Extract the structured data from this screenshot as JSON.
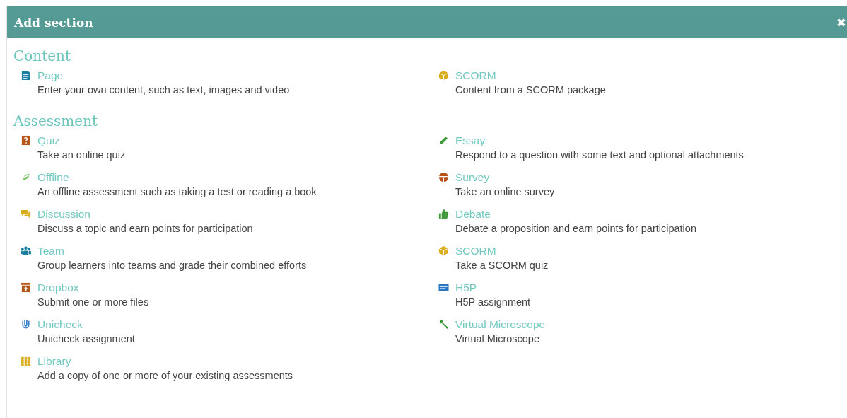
{
  "dialog": {
    "title": "Add section",
    "close": "✖"
  },
  "sections": [
    {
      "heading": "Content",
      "items": [
        {
          "kind": "page",
          "title": "Page",
          "description": "Enter your own content, such as text, images and video"
        },
        {
          "kind": "scorm",
          "title": "SCORM",
          "description": "Content from a SCORM package"
        }
      ]
    },
    {
      "heading": "Assessment",
      "items": [
        {
          "kind": "quiz",
          "title": "Quiz",
          "description": "Take an online quiz"
        },
        {
          "kind": "essay",
          "title": "Essay",
          "description": "Respond to a question with some text and optional attachments"
        },
        {
          "kind": "offline",
          "title": "Offline",
          "description": "An offline assessment such as taking a test or reading a book"
        },
        {
          "kind": "survey",
          "title": "Survey",
          "description": "Take an online survey"
        },
        {
          "kind": "discussion",
          "title": "Discussion",
          "description": "Discuss a topic and earn points for participation"
        },
        {
          "kind": "debate",
          "title": "Debate",
          "description": "Debate a proposition and earn points for participation"
        },
        {
          "kind": "team",
          "title": "Team",
          "description": "Group learners into teams and grade their combined efforts"
        },
        {
          "kind": "scorm",
          "title": "SCORM",
          "description": "Take a SCORM quiz"
        },
        {
          "kind": "dropbox",
          "title": "Dropbox",
          "description": "Submit one or more files"
        },
        {
          "kind": "h5p",
          "title": "H5P",
          "description": "H5P assignment"
        },
        {
          "kind": "unicheck",
          "title": "Unicheck",
          "description": "Unicheck assignment"
        },
        {
          "kind": "microscope",
          "title": "Virtual Microscope",
          "description": "Virtual Microscope"
        },
        {
          "kind": "library",
          "title": "Library",
          "description": "Add a copy of one or more of your existing assessments"
        }
      ]
    }
  ]
}
